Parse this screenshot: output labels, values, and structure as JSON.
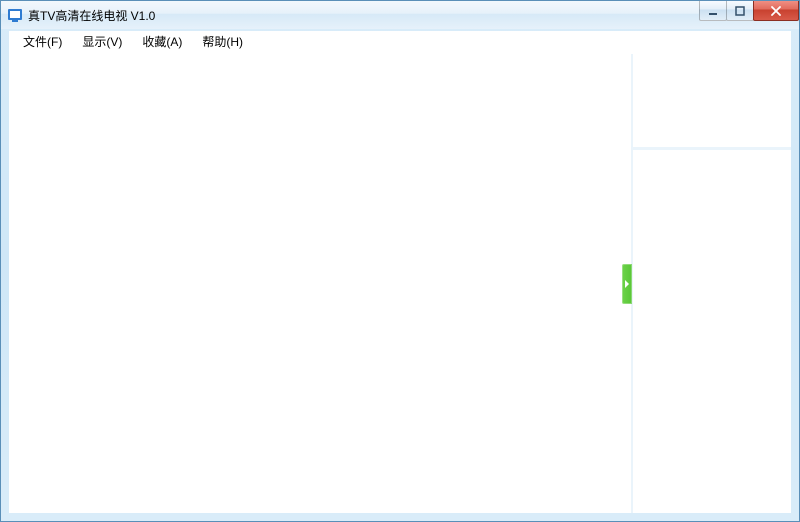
{
  "window": {
    "title": "真TV高清在线电视 V1.0"
  },
  "menu": {
    "file": "文件(F)",
    "view": "显示(V)",
    "favorites": "收藏(A)",
    "help": "帮助(H)"
  }
}
